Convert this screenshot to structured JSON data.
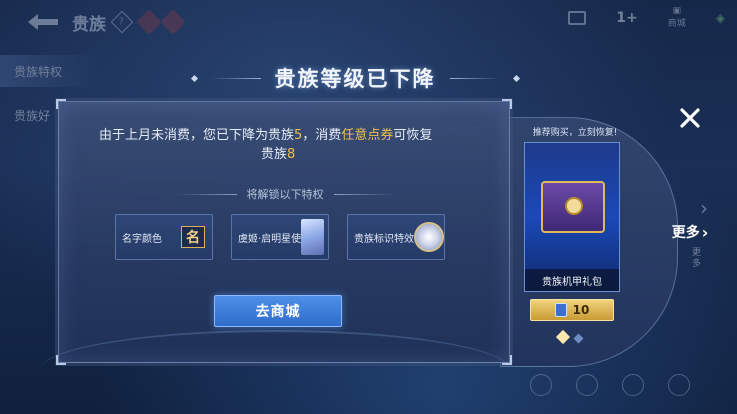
{
  "background": {
    "top_title": "贵族",
    "help_glyph": "?",
    "count": "1+",
    "store_label": "商城",
    "sidebar": [
      {
        "label": "贵族特权"
      },
      {
        "label": "贵族好"
      }
    ]
  },
  "modal": {
    "title": "贵族等级已下降",
    "message_part1": "由于上月未消费，您已下降为贵族",
    "current_level": "5",
    "message_part2": "，消费",
    "highlight_term": "任意点券",
    "message_part3": "可恢复",
    "message_line2_prefix": "贵族",
    "restore_level": "8",
    "section_label": "将解锁以下特权",
    "privileges": [
      {
        "label": "名字颜色",
        "icon": "name-color-icon",
        "icon_glyph": "名"
      },
      {
        "label": "虞姬·启明星使",
        "icon": "skin-portrait-icon"
      },
      {
        "label": "贵族标识特效",
        "icon": "noble-emblem-icon"
      }
    ],
    "shop_button": "去商城"
  },
  "gift": {
    "promo": "推荐购买，立刻恢复!",
    "name": "贵族机甲礼包",
    "price": "10",
    "more_label": "更多",
    "side_more": "更多"
  },
  "colors": {
    "highlight": "#f0c04a",
    "restore": "#f0c04a",
    "button_blue": "#2f6dcc"
  }
}
